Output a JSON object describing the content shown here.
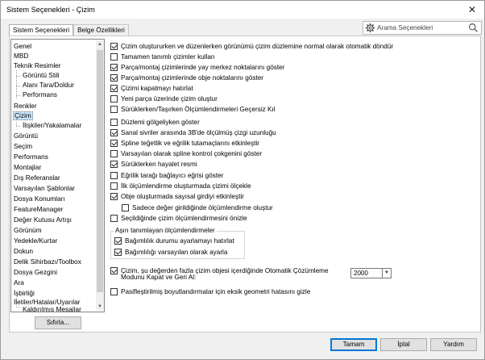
{
  "window": {
    "title": "Sistem Seçenekleri - Çizim",
    "close_glyph": "✕"
  },
  "tabs": [
    "Sistem Seçenekleri",
    "Belge Özellikleri"
  ],
  "search": {
    "placeholder": "Arama Seçenekleri"
  },
  "tree": {
    "items": [
      "Genel",
      "MBD",
      "Teknik Resimler",
      "Görüntü Stili",
      "Alanı Tara/Doldur",
      "Performans",
      "Renkler",
      "Çizim",
      "İlişkiler/Yakalamalar",
      "Görüntü",
      "Seçim",
      "Performans",
      "Montajlar",
      "Dış Referanslar",
      "Varsayılan Şablonlar",
      "Dosya Konumları",
      "FeatureManager",
      "Değer Kutusu Artışı",
      "Görünüm",
      "Yedekle/Kurtar",
      "Dokun",
      "Delik Sihirbazı/Toolbox",
      "Dosya Gezgini",
      "Ara",
      "İşbirliği",
      "İletiler/Hatalar/Uyarılar",
      "Kaldırılmış Mesajlar"
    ],
    "selected": "Çizim"
  },
  "reset_button": "Sıfırla...",
  "options": [
    {
      "label": "Çizim oluştururken ve düzenlerken görünümü çizim düzlemine normal olarak otomatik döndür",
      "checked": true
    },
    {
      "label": "Tamamen tanımlı çizimler kullan",
      "checked": false
    },
    {
      "label": "Parça/montaj çizimlerinde yay merkez noktalarını göster",
      "checked": true
    },
    {
      "label": "Parça/montaj çizimlerinde obje noktalarını göster",
      "checked": true
    },
    {
      "label": "Çizimi kapatmayı hatırlat",
      "checked": true
    },
    {
      "label": "Yeni parça üzerinde çizim oluştur",
      "checked": false
    },
    {
      "label": "Sürüklerken/Taşırken Ölçümlendirmeleri Geçersiz Kıl",
      "checked": false
    },
    {
      "label": "Düzlemi gölgeliyken göster",
      "checked": false
    },
    {
      "label": "Sanal sivriler arasında 3B'de ölçülmüş çizgi uzunluğu",
      "checked": true
    },
    {
      "label": "Spline teğetlik ve eğrilik tutamaçlarını etkinleştir",
      "checked": true
    },
    {
      "label": "Varsayılan olarak spline kontrol çokgenini göster",
      "checked": false
    },
    {
      "label": "Sürüklerken hayalet resmi",
      "checked": true
    },
    {
      "label": "Eğrilik tarağı bağlayıcı eğrisi göster",
      "checked": false
    },
    {
      "label": "İlk ölçümlendirme oluşturmada çizimi ölçekle",
      "checked": false
    },
    {
      "label": "Obje oluşturmada sayısal girdiyi etkinleştir",
      "checked": true
    },
    {
      "label": "Sadece değer girildiğinde ölçümlendirme oluştur",
      "checked": false
    },
    {
      "label": "Seçildiğinde çizim ölçümlendirmesini önizle",
      "checked": false
    }
  ],
  "overdef_group": {
    "title": "Aşırı tanımlayan ölçümlendirmeler",
    "items": [
      {
        "label": "Bağımlılık durumu ayarlamayı hatırlat",
        "checked": true
      },
      {
        "label": "Bağımlılığı varsayılan olarak ayarla",
        "checked": true
      }
    ]
  },
  "auto_solve": {
    "label_line1": "Çizim, şu değerden fazla çizim objesi içerdiğinde Otomatik Çözümleme",
    "label_line2": "Modunu Kapat ve Geri Al:",
    "checked": true,
    "value": "2000"
  },
  "last_option": {
    "label": "Pasifleştirilmiş boyutlandırmalar için eksik geometri hatasını gizle",
    "checked": false
  },
  "footer": {
    "ok": "Tamam",
    "cancel": "İptal",
    "help": "Yardım"
  }
}
